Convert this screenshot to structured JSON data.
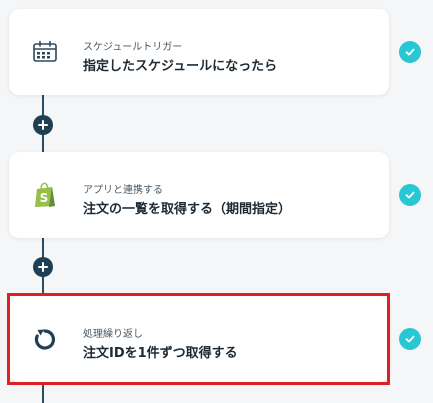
{
  "flow": {
    "steps": [
      {
        "category": "スケジュールトリガー",
        "title": "指定したスケジュールになったら",
        "icon": "calendar-schedule-icon",
        "status": "completed"
      },
      {
        "category": "アプリと連携する",
        "title": "注文の一覧を取得する（期間指定）",
        "icon": "shopify-bag-icon",
        "status": "completed"
      },
      {
        "category": "処理繰り返し",
        "title": "注文IDを1件ずつ取得する",
        "icon": "loop-arrow-icon",
        "status": "completed",
        "selected": true
      }
    ],
    "add_step_icon": "plus-icon",
    "colors": {
      "accent_check": "#29c6d3",
      "connector": "#2b4a5e",
      "selection_border": "#dd1f26",
      "shopify_green": "#95bf47"
    }
  }
}
